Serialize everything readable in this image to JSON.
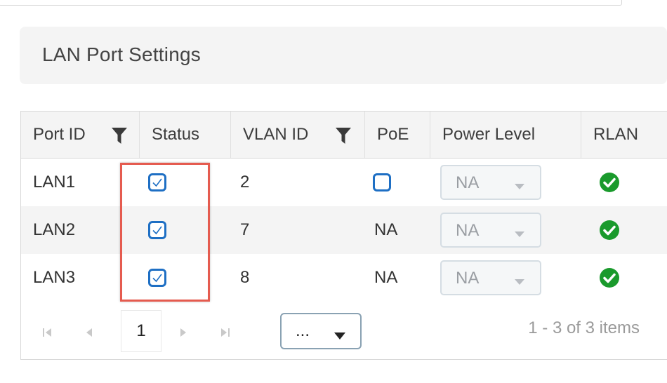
{
  "section": {
    "title": "LAN Port Settings"
  },
  "table": {
    "columns": [
      {
        "label": "Port ID",
        "filter": true
      },
      {
        "label": "Status",
        "filter": false
      },
      {
        "label": "VLAN ID",
        "filter": true
      },
      {
        "label": "PoE",
        "filter": false
      },
      {
        "label": "Power Level",
        "filter": false
      },
      {
        "label": "RLAN",
        "filter": false
      }
    ],
    "rows": [
      {
        "port_id": "LAN1",
        "status_checked": true,
        "vlan_id": "2",
        "poe": "",
        "poe_checkbox": true,
        "poe_checked": false,
        "power_level": "NA",
        "rlan": "check-circle-icon"
      },
      {
        "port_id": "LAN2",
        "status_checked": true,
        "vlan_id": "7",
        "poe": "NA",
        "poe_checkbox": false,
        "poe_checked": false,
        "power_level": "NA",
        "rlan": "check-circle-icon"
      },
      {
        "port_id": "LAN3",
        "status_checked": true,
        "vlan_id": "8",
        "poe": "NA",
        "poe_checkbox": false,
        "poe_checked": false,
        "power_level": "NA",
        "rlan": "check-circle-icon"
      }
    ]
  },
  "pager": {
    "current_page": "1",
    "page_size_value": "...",
    "info": "1 - 3 of 3 items"
  },
  "colors": {
    "checkbox_blue": "#1e6fc4",
    "rlan_green": "#1a9a2c",
    "highlight_red": "#e55b4f"
  }
}
